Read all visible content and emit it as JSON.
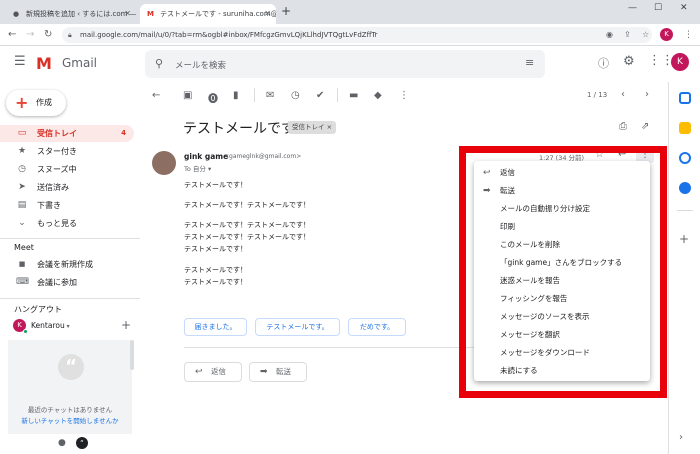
{
  "browser": {
    "tabs": [
      {
        "title": "新規投稿を追加 ‹ するには.com —",
        "active": false
      },
      {
        "title": "テストメールです - suruniha.com@g",
        "active": true
      }
    ],
    "new_tab": "+",
    "url": "mail.google.com/mail/u/0/?tab=rm&ogbl#inbox/FMfcgzGmvLQjKLlhdJVTQgtLvFdZffTr"
  },
  "gmail": {
    "brand": "Gmail",
    "search_placeholder": "メールを検索",
    "avatar_letter": "K",
    "colors": {
      "red": "#d93025",
      "blue": "#1a73e8",
      "highlight": "#e8000b"
    }
  },
  "sidebar": {
    "compose_label": "作成",
    "items": [
      {
        "label": "受信トレイ",
        "count": "4",
        "icon": "inbox-icon",
        "glyph": "▭",
        "active": true
      },
      {
        "label": "スター付き",
        "count": "",
        "icon": "star-icon",
        "glyph": "★",
        "active": false
      },
      {
        "label": "スヌーズ中",
        "count": "",
        "icon": "clock-icon",
        "glyph": "◷",
        "active": false
      },
      {
        "label": "送信済み",
        "count": "",
        "icon": "send-icon",
        "glyph": "➤",
        "active": false
      },
      {
        "label": "下書き",
        "count": "",
        "icon": "draft-icon",
        "glyph": "▤",
        "active": false
      },
      {
        "label": "もっと見る",
        "count": "",
        "icon": "chevron-down-icon",
        "glyph": "⌄",
        "active": false
      }
    ],
    "meet_title": "Meet",
    "meet_items": [
      {
        "label": "会議を新規作成",
        "icon": "video-icon",
        "glyph": "■"
      },
      {
        "label": "会議に参加",
        "icon": "keyboard-icon",
        "glyph": "⌨"
      }
    ],
    "hangouts_title": "ハングアウト",
    "hangouts_user": "Kentarou",
    "hangouts_add": "+",
    "no_chats": "最近のチャットはありません",
    "new_chat_link": "新しいチャットを開始しませんか"
  },
  "toolbar": {
    "pagination": "1 / 13"
  },
  "message": {
    "subject": "テストメールです",
    "label_chip": "受信トレイ",
    "label_chip_close": "×",
    "sender_name": "gink game",
    "sender_email": "<gameglnk@gmail.com>",
    "to_line": "To 自分",
    "time": "1:27 (34 分前)",
    "body": [
      "テストメールです！",
      "",
      "テストメールです！テストメールです！",
      "",
      "テストメールです！テストメールです！",
      "テストメールです！テストメールです！",
      "テストメールです！",
      "",
      "テストメールです！",
      "テストメールです！"
    ],
    "smart_replies": [
      "届きました。",
      "テストメールです。",
      "だめです。"
    ],
    "reply_button": "返信",
    "forward_button": "転送"
  },
  "menu": {
    "items": [
      {
        "label": "返信",
        "icon": "reply-icon",
        "glyph": "↩"
      },
      {
        "label": "転送",
        "icon": "forward-icon",
        "glyph": "➡"
      },
      {
        "label": "メールの自動振り分け設定",
        "icon": "",
        "glyph": ""
      },
      {
        "label": "印刷",
        "icon": "",
        "glyph": ""
      },
      {
        "label": "このメールを削除",
        "icon": "",
        "glyph": ""
      },
      {
        "label": "「gink game」さんをブロックする",
        "icon": "",
        "glyph": ""
      },
      {
        "label": "迷惑メールを報告",
        "icon": "",
        "glyph": ""
      },
      {
        "label": "フィッシングを報告",
        "icon": "",
        "glyph": ""
      },
      {
        "label": "メッセージのソースを表示",
        "icon": "",
        "glyph": ""
      },
      {
        "label": "メッセージを翻訳",
        "icon": "",
        "glyph": ""
      },
      {
        "label": "メッセージをダウンロード",
        "icon": "",
        "glyph": ""
      },
      {
        "label": "未読にする",
        "icon": "",
        "glyph": ""
      }
    ]
  }
}
